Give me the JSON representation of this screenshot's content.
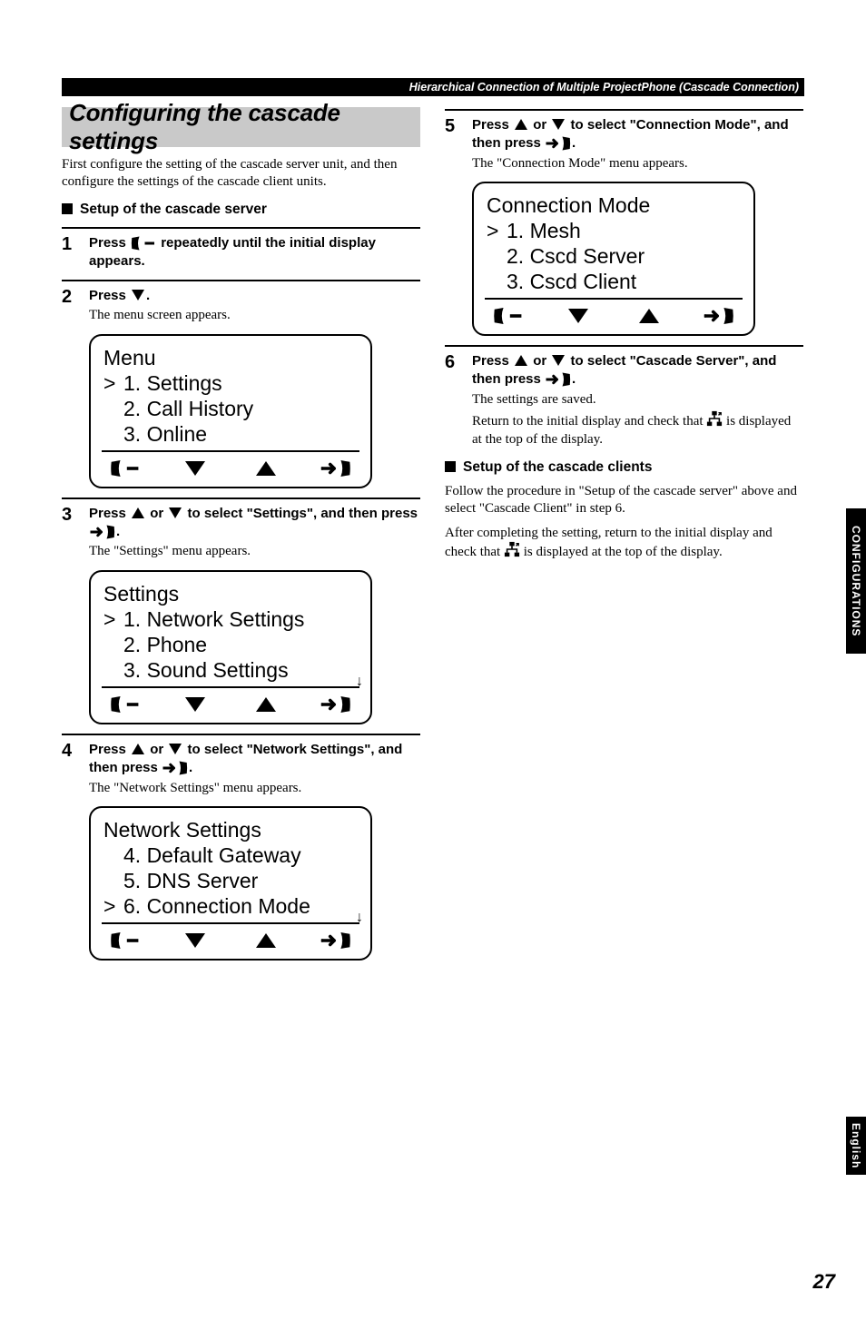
{
  "topbar": "Hierarchical Connection of Multiple ProjectPhone (Cascade Connection)",
  "headline": "Configuring the cascade settings",
  "intro": "First configure the setting of the cascade server unit, and then configure the settings of the cascade client units.",
  "subhead_server": "Setup of the cascade server",
  "step1": {
    "pre": "Press ",
    "post": " repeatedly until the initial display appears."
  },
  "step2": {
    "bold_pre": "Press ",
    "bold_post": ".",
    "body": "The menu screen appears."
  },
  "lcd_menu": {
    "title": "Menu",
    "items": [
      "1. Settings",
      "2. Call History",
      "3. Online"
    ],
    "selected": 0
  },
  "step3": {
    "bold_pre": "Press ",
    "bold_mid": " or ",
    "bold_seg2": " to select \"Settings\", and then press ",
    "bold_post": ".",
    "body": "The \"Settings\" menu appears."
  },
  "lcd_settings": {
    "title": "Settings",
    "items": [
      "1. Network Settings",
      "2. Phone",
      "3. Sound Settings"
    ],
    "selected": 0,
    "scroll": true
  },
  "step4": {
    "bold_pre": "Press ",
    "bold_mid": " or ",
    "bold_seg2": " to select \"Network Settings\", and then press ",
    "bold_post": ".",
    "body": "The \"Network Settings\" menu appears."
  },
  "lcd_network": {
    "title": "Network Settings",
    "items": [
      "4. Default Gateway",
      "5. DNS Server",
      "6. Connection Mode"
    ],
    "selected": 2,
    "scroll": true
  },
  "step5": {
    "bold_pre": "Press ",
    "bold_mid": " or ",
    "bold_seg2": " to select \"Connection Mode\", and then press ",
    "bold_post": ".",
    "body": "The \"Connection Mode\" menu appears."
  },
  "lcd_conn": {
    "title": "Connection Mode",
    "items": [
      "1. Mesh",
      "2. Cscd Server",
      "3. Cscd Client"
    ],
    "selected": 0
  },
  "step6": {
    "bold_pre": "Press ",
    "bold_mid": " or ",
    "bold_seg2": " to select \"Cascade Server\", and then press ",
    "bold_post": ".",
    "body1": "The settings are saved.",
    "body2_pre": "Return to the initial display and check that ",
    "body2_post": " is displayed at the top of the display."
  },
  "subhead_clients": "Setup of the cascade clients",
  "clients_p1": "Follow the procedure in \"Setup of the cascade server\" above and select \"Cascade Client\" in step 6.",
  "clients_p2_pre": "After completing the setting, return to the initial display and check that ",
  "clients_p2_post": " is displayed at the top of the display.",
  "tab_conf": "CONFIGURATIONS",
  "tab_lang": "English",
  "pagenum": "27"
}
